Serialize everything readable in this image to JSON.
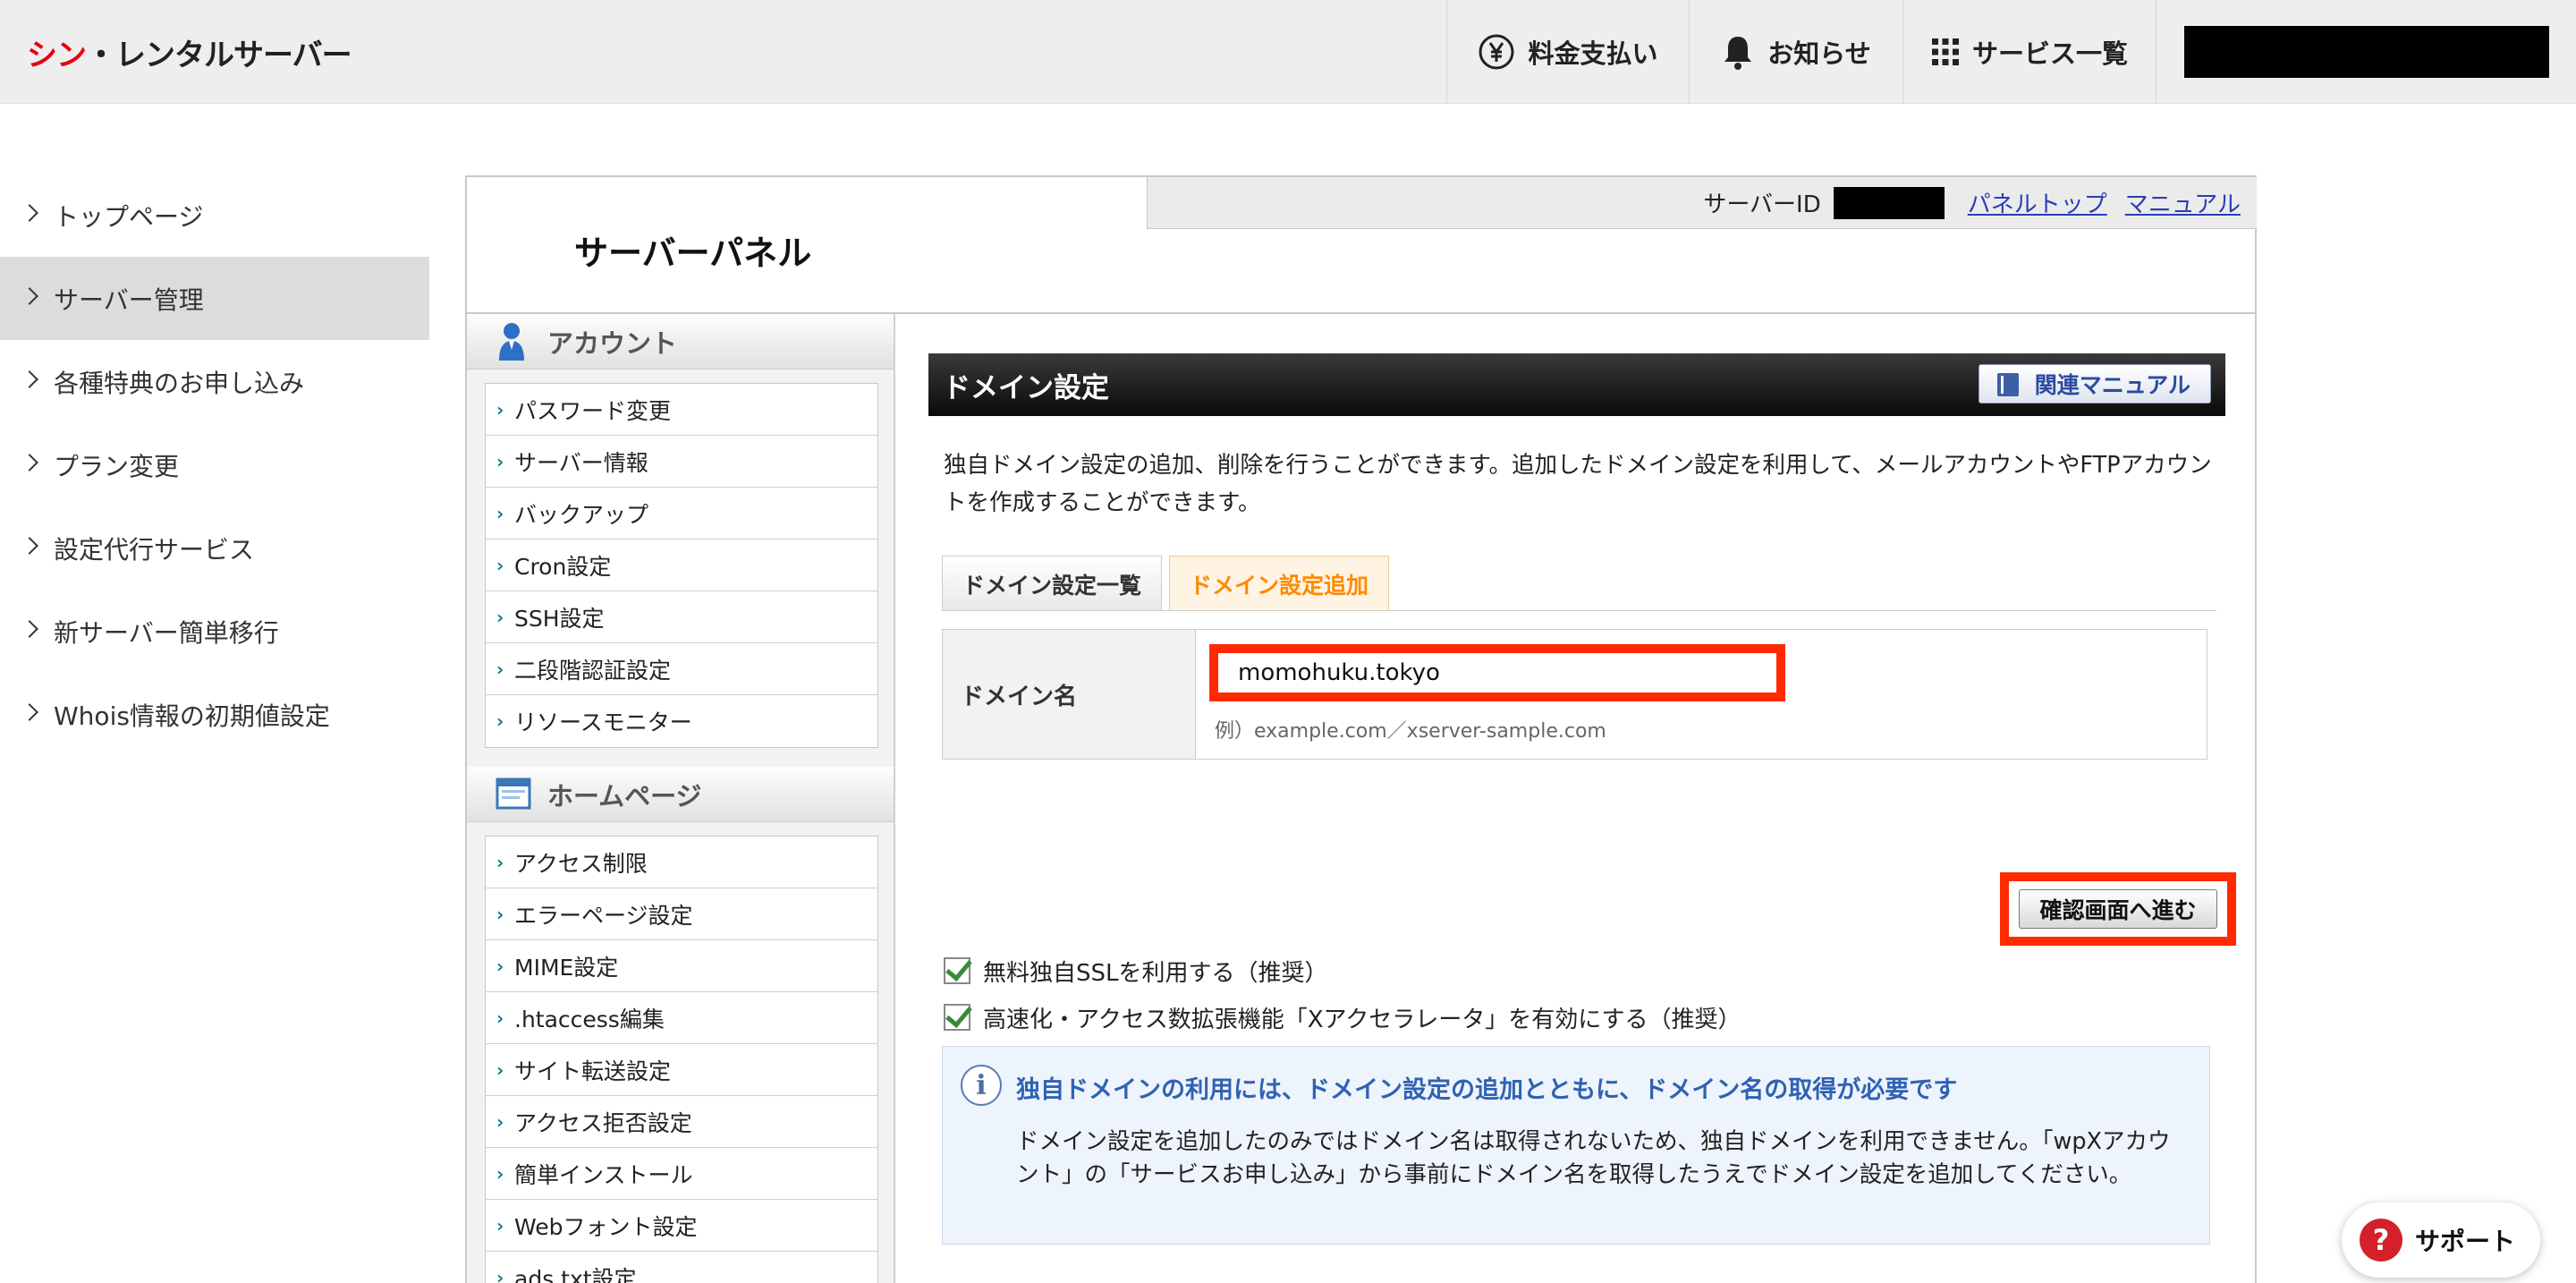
{
  "header": {
    "logo_red": "シン",
    "logo_rest": "・レンタルサーバー",
    "billing_label": "料金支払い",
    "notice_label": "お知らせ",
    "services_label": "サービス一覧"
  },
  "sidenav": {
    "items": [
      {
        "label": "トップページ"
      },
      {
        "label": "サーバー管理"
      },
      {
        "label": "各種特典のお申し込み"
      },
      {
        "label": "プラン変更"
      },
      {
        "label": "設定代行サービス"
      },
      {
        "label": "新サーバー簡単移行"
      },
      {
        "label": "Whois情報の初期値設定"
      }
    ],
    "active_index": 1
  },
  "panel": {
    "title": "サーバーパネル",
    "server_id_label": "サーバーID",
    "link_panel_top": "パネルトップ",
    "link_manual": "マニュアル"
  },
  "menu": {
    "account_title": "アカウント",
    "account_items": [
      "パスワード変更",
      "サーバー情報",
      "バックアップ",
      "Cron設定",
      "SSH設定",
      "二段階認証設定",
      "リソースモニター"
    ],
    "homepage_title": "ホームページ",
    "homepage_items": [
      "アクセス制限",
      "エラーページ設定",
      "MIME設定",
      ".htaccess編集",
      "サイト転送設定",
      "アクセス拒否設定",
      "簡単インストール",
      "Webフォント設定",
      "ads.txt設定"
    ]
  },
  "content": {
    "section_title": "ドメイン設定",
    "manual_button": "関連マニュアル",
    "description": "独自ドメイン設定の追加、削除を行うことができます。追加したドメイン設定を利用して、メールアカウントやFTPアカウントを作成することができます。",
    "tabs": [
      {
        "label": "ドメイン設定一覧",
        "active": false
      },
      {
        "label": "ドメイン設定追加",
        "active": true
      }
    ],
    "domain_label": "ドメイン名",
    "domain_value": "momohuku.tokyo",
    "domain_example": "例）example.com／xserver-sample.com",
    "checkbox_ssl": {
      "label": "無料独自SSLを利用する（推奨）",
      "checked": true
    },
    "checkbox_accel": {
      "label": "高速化・アクセス数拡張機能「Xアクセラレータ」を有効にする（推奨）",
      "checked": true
    },
    "confirm_button": "確認画面へ進む",
    "info_title": "独自ドメインの利用には、ドメイン設定の追加とともに、ドメイン名の取得が必要です",
    "info_text": "ドメイン設定を追加したのみではドメイン名は取得されないため、独自ドメインを利用できません。「wpXアカウント」の「サービスお申し込み」から事前にドメイン名を取得したうえでドメイン設定を追加してください。"
  },
  "support": {
    "icon_text": "?",
    "label": "サポート"
  },
  "colors": {
    "highlight_red": "#ff2a00",
    "active_tab_orange": "#ff8a00",
    "link_blue": "#2a3fb5",
    "info_title_blue": "#2f62b3",
    "logo_red": "#e60012"
  }
}
